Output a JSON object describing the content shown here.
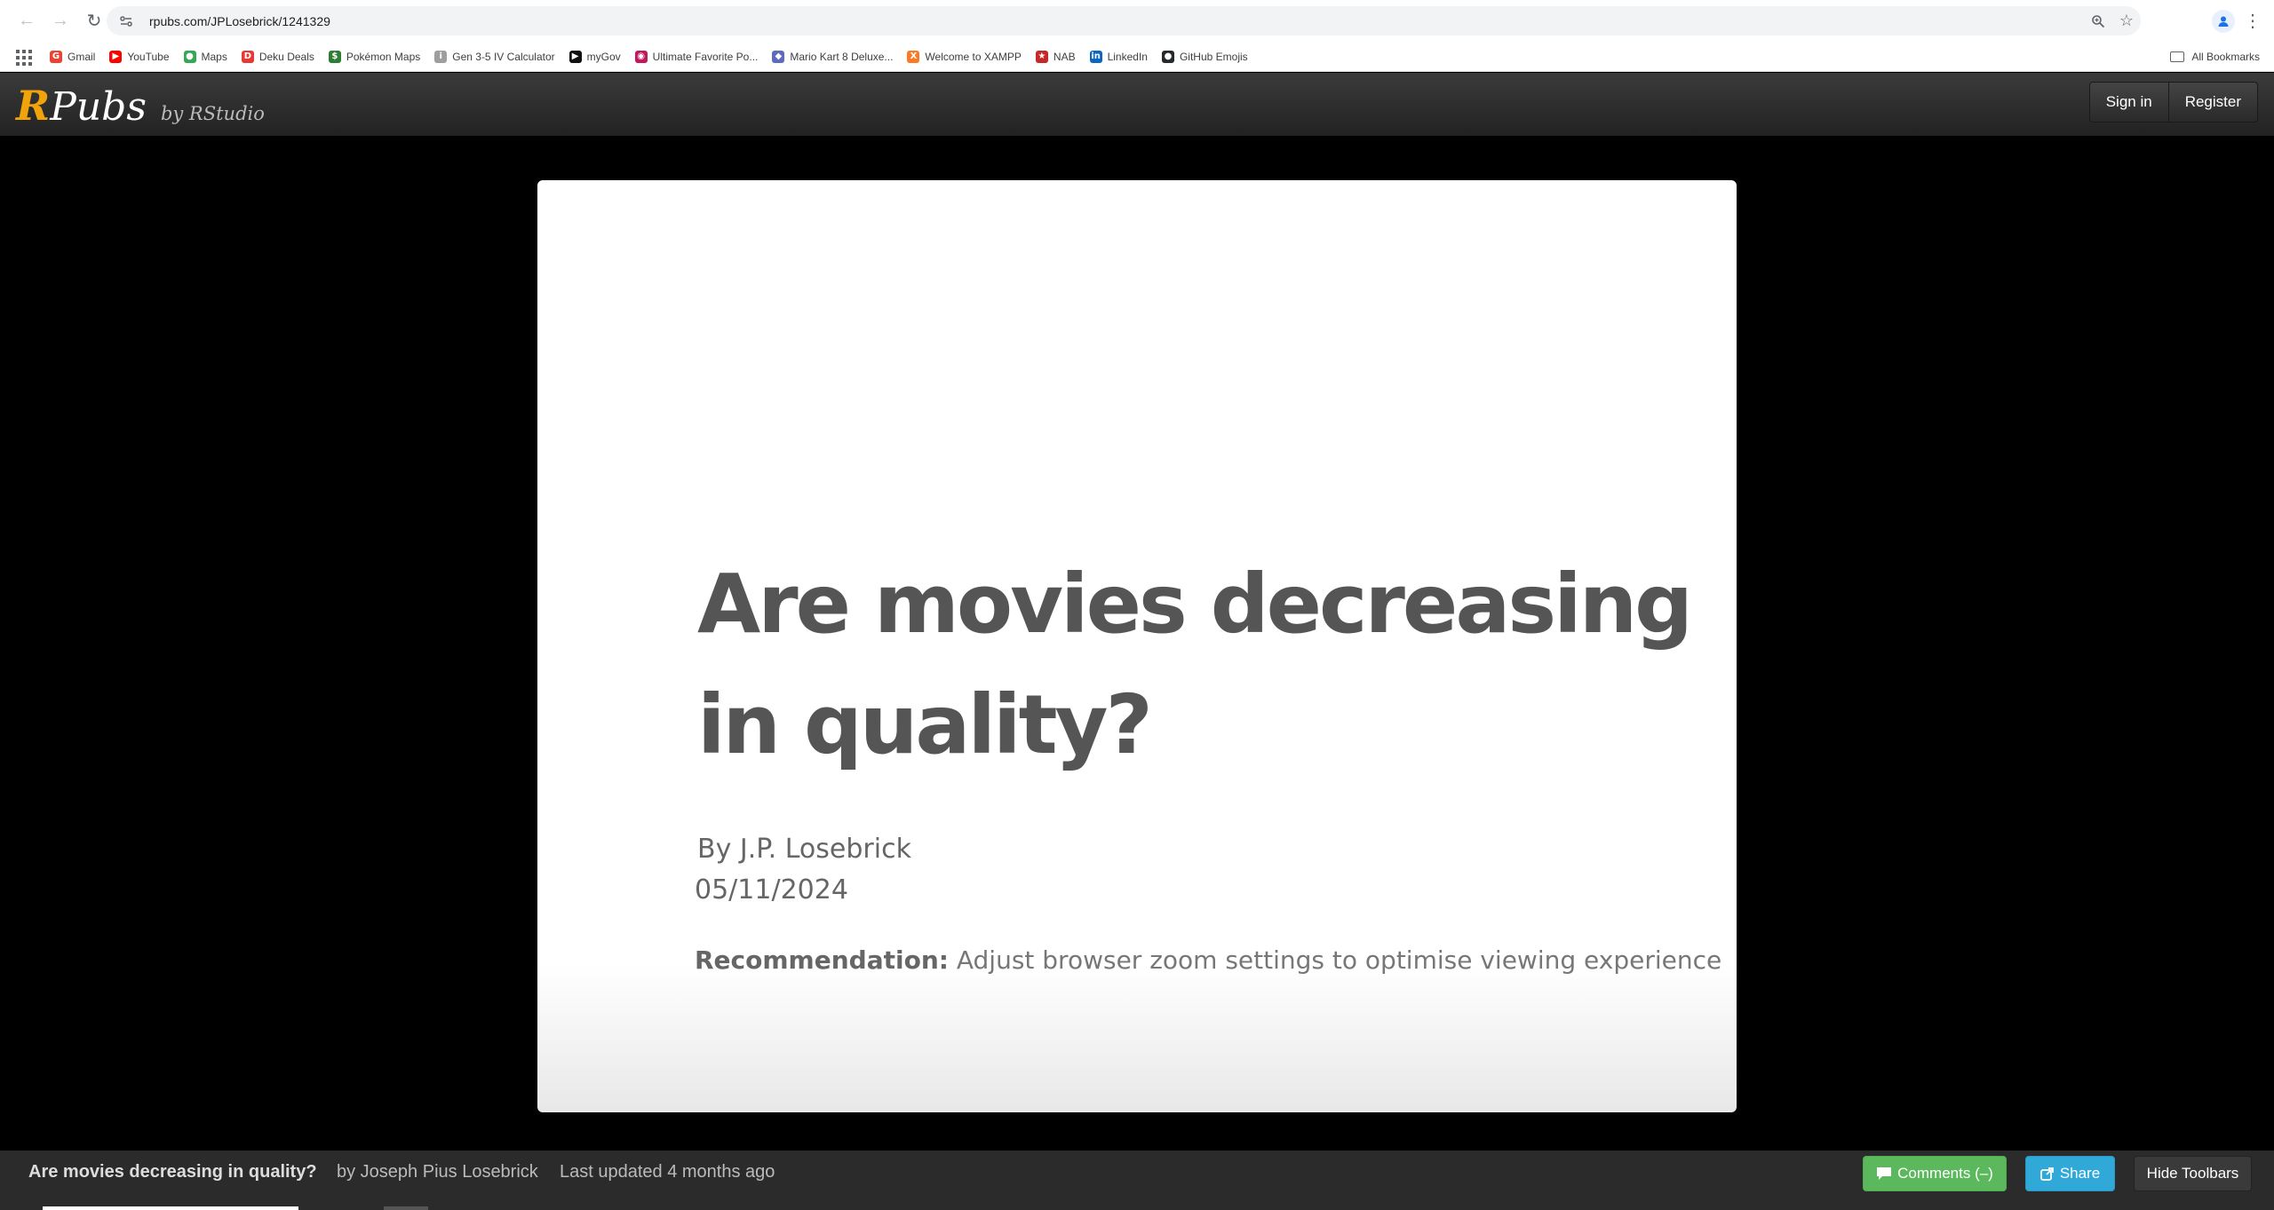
{
  "browser": {
    "url": "rpubs.com/JPLosebrick/1241329",
    "bookmarks": [
      {
        "label": "Gmail",
        "icon": "gmail-icon",
        "color": "#ea4335",
        "glyph": "G"
      },
      {
        "label": "YouTube",
        "icon": "youtube-icon",
        "color": "#ff0000",
        "glyph": "▶"
      },
      {
        "label": "Maps",
        "icon": "maps-icon",
        "color": "#34a853",
        "glyph": "●"
      },
      {
        "label": "Deku Deals",
        "icon": "deku-deals-icon",
        "color": "#e53935",
        "glyph": "D"
      },
      {
        "label": "Pokémon Maps",
        "icon": "pokemon-maps-icon",
        "color": "#2e7d32",
        "glyph": "$"
      },
      {
        "label": "Gen 3-5 IV Calculator",
        "icon": "iv-calculator-icon",
        "color": "#9e9e9e",
        "glyph": "i"
      },
      {
        "label": "myGov",
        "icon": "mygov-icon",
        "color": "#111111",
        "glyph": "▶"
      },
      {
        "label": "Ultimate Favorite Po...",
        "icon": "favorite-icon",
        "color": "#c2185b",
        "glyph": "◉"
      },
      {
        "label": "Mario Kart 8 Deluxe...",
        "icon": "mario-kart-icon",
        "color": "#5c6bc0",
        "glyph": "◆"
      },
      {
        "label": "Welcome to XAMPP",
        "icon": "xampp-icon",
        "color": "#fb7a24",
        "glyph": "X"
      },
      {
        "label": "NAB",
        "icon": "nab-icon",
        "color": "#c62828",
        "glyph": "★"
      },
      {
        "label": "LinkedIn",
        "icon": "linkedin-icon",
        "color": "#0a66c2",
        "glyph": "in"
      },
      {
        "label": "GitHub Emojis",
        "icon": "github-icon",
        "color": "#24292e",
        "glyph": "●"
      }
    ],
    "all_bookmarks": "All Bookmarks"
  },
  "header": {
    "logo_r": "R",
    "logo_pubs": "Pubs",
    "logo_by": "by RStudio",
    "sign_in": "Sign in",
    "register": "Register"
  },
  "slide": {
    "title": "Are movies decreasing in quality?",
    "author": "By J.P. Losebrick",
    "date": "05/11/2024",
    "rec_label": "Recommendation:",
    "rec_text": " Adjust browser zoom settings to optimise viewing experience"
  },
  "footer": {
    "title": "Are movies decreasing in quality?",
    "author": "by Joseph Pius Losebrick",
    "updated": "Last updated 4 months ago",
    "comments": "Comments (–)",
    "share": "Share",
    "hide": "Hide Toolbars"
  }
}
